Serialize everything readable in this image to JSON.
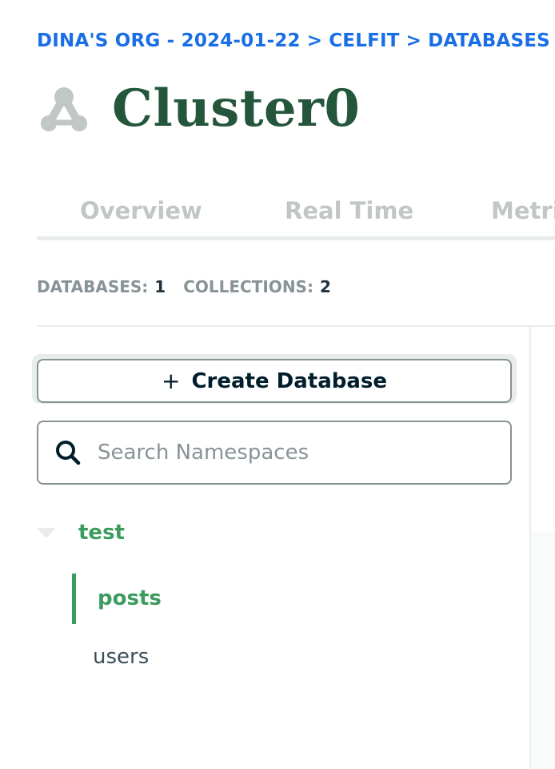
{
  "breadcrumb": {
    "org": "DINA'S ORG - 2024-01-22",
    "project": "CELFIT",
    "section": "DATABASES",
    "separator": ">"
  },
  "cluster": {
    "name": "Cluster0",
    "icon": "cluster-icon"
  },
  "tabs": [
    {
      "label": "Overview"
    },
    {
      "label": "Real Time"
    },
    {
      "label": "Metri"
    }
  ],
  "stats": {
    "databases_label": "DATABASES:",
    "databases_count": "1",
    "collections_label": "COLLECTIONS:",
    "collections_count": "2"
  },
  "create_button": {
    "plus": "+",
    "label": "Create Database"
  },
  "search": {
    "placeholder": "Search Namespaces",
    "value": "",
    "icon": "search-icon"
  },
  "tree": {
    "database": "test",
    "collections": [
      {
        "name": "posts",
        "active": true
      },
      {
        "name": "users",
        "active": false
      }
    ]
  },
  "colors": {
    "link": "#1a6ee5",
    "title": "#24563c",
    "accent": "#3d9b5f",
    "muted": "#889397",
    "text": "#21313c"
  }
}
